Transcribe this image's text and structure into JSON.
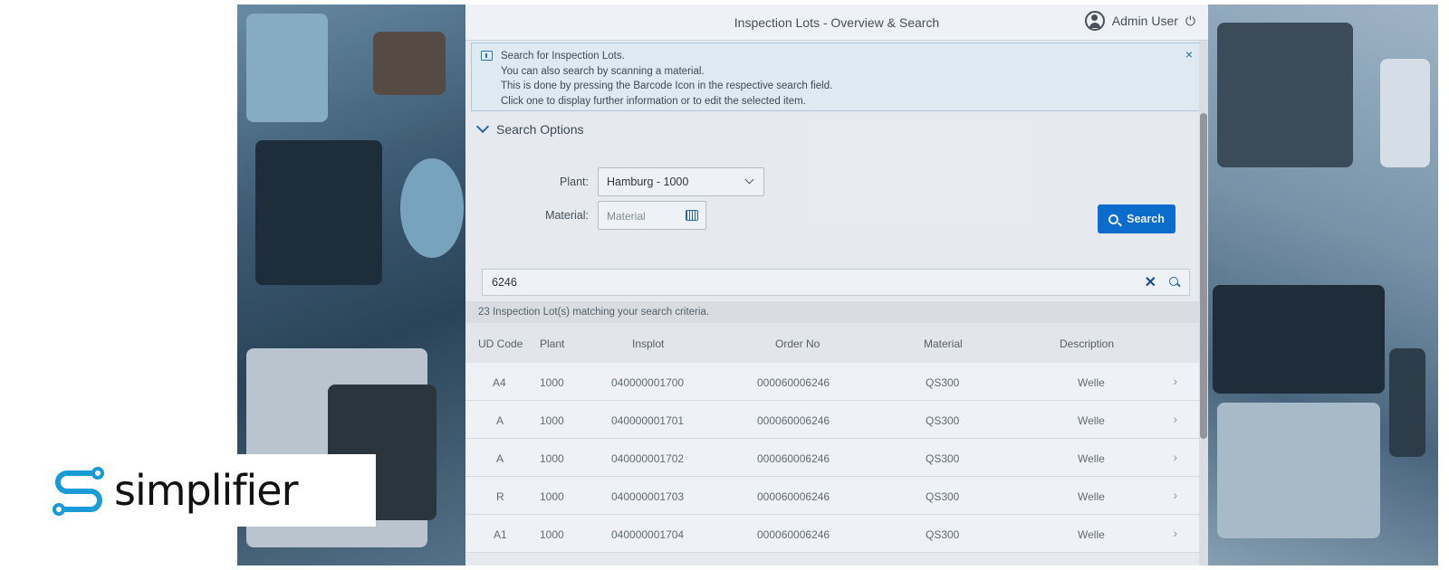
{
  "app": {
    "title": "Inspection Lots - Overview & Search",
    "user_name": "Admin User"
  },
  "info": {
    "lines": [
      "Search for Inspection Lots.",
      "You can also search by scanning a material.",
      "This is done by pressing the Barcode Icon in the respective search field.",
      "Click one to display further information or to edit the selected item."
    ],
    "close_label": "×"
  },
  "search_options": {
    "title": "Search Options",
    "plant_label": "Plant:",
    "plant_value": "Hamburg - 1000",
    "material_label": "Material:",
    "material_placeholder": "Material",
    "search_button": "Search"
  },
  "filter": {
    "value": "6246"
  },
  "results": {
    "count_text": "23 Inspection Lot(s) matching your search criteria.",
    "columns": [
      "UD Code",
      "Plant",
      "Insplot",
      "Order No",
      "Material",
      "Description"
    ],
    "rows": [
      [
        "A4",
        "1000",
        "040000001700",
        "000060006246",
        "QS300",
        "Welle"
      ],
      [
        "A",
        "1000",
        "040000001701",
        "000060006246",
        "QS300",
        "Welle"
      ],
      [
        "A",
        "1000",
        "040000001702",
        "000060006246",
        "QS300",
        "Welle"
      ],
      [
        "R",
        "1000",
        "040000001703",
        "000060006246",
        "QS300",
        "Welle"
      ],
      [
        "A1",
        "1000",
        "040000001704",
        "000060006246",
        "QS300",
        "Welle"
      ]
    ]
  },
  "logo": {
    "text": "simplifier",
    "color": "#1a9ad6"
  },
  "colors": {
    "primary_button": "#0a6ed1",
    "info_border": "#b6d3e6"
  }
}
